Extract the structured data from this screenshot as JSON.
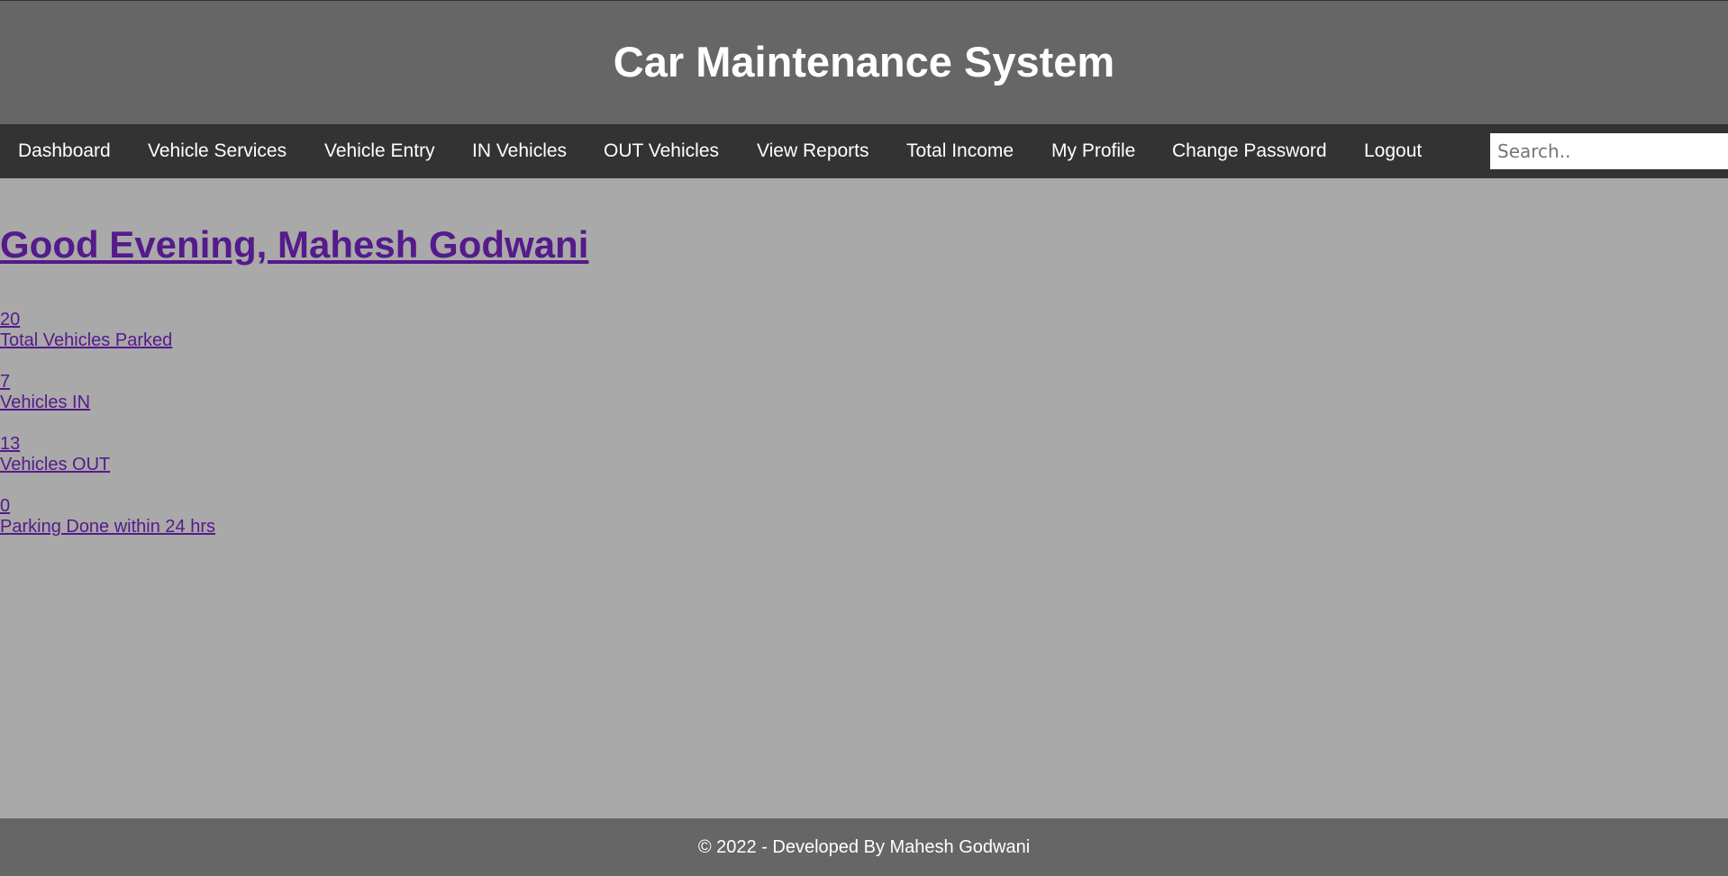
{
  "header": {
    "title": "Car Maintenance System"
  },
  "nav": {
    "items": [
      {
        "label": "Dashboard"
      },
      {
        "label": "Vehicle Services"
      },
      {
        "label": "Vehicle Entry"
      },
      {
        "label": "IN Vehicles"
      },
      {
        "label": "OUT Vehicles"
      },
      {
        "label": "View Reports"
      },
      {
        "label": "Total Income"
      },
      {
        "label": "My Profile"
      },
      {
        "label": "Change Password"
      },
      {
        "label": "Logout"
      }
    ],
    "search": {
      "placeholder": "Search..",
      "value": ""
    }
  },
  "main": {
    "greeting": "Good Evening, Mahesh Godwani",
    "stats": [
      {
        "value": "20",
        "label": "Total Vehicles Parked"
      },
      {
        "value": "7",
        "label": "Vehicles IN"
      },
      {
        "value": "13",
        "label": "Vehicles OUT"
      },
      {
        "value": "0",
        "label": "Parking Done within 24 hrs"
      }
    ]
  },
  "footer": {
    "text": "© 2022 - Developed By Mahesh Godwani"
  },
  "colors": {
    "header_bg": "#666666",
    "nav_bg": "#333333",
    "page_bg": "#a9a9a9",
    "link": "#551a8b",
    "footer_bg": "#666666"
  }
}
